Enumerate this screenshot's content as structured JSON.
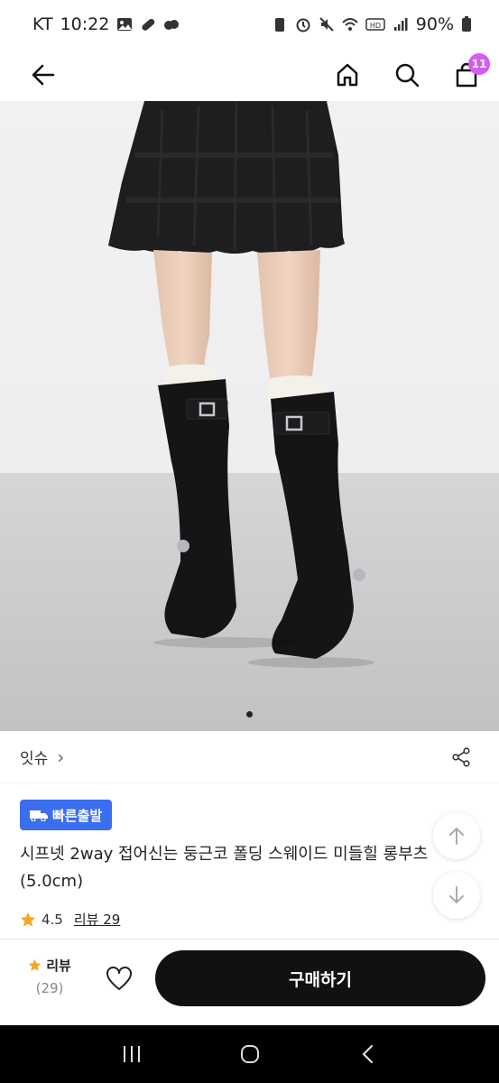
{
  "status_bar": {
    "carrier": "KT",
    "time": "10:22",
    "battery": "90%",
    "left_icons": [
      "gallery-icon",
      "pill-icon",
      "cloud-icon"
    ],
    "right_icons": [
      "battery-saver-icon",
      "alarm-icon",
      "mute-icon",
      "wifi-icon",
      "hd-icon",
      "signal-icon",
      "battery-icon"
    ]
  },
  "nav": {
    "cart_count": "11",
    "badge_color": "#d65bf0"
  },
  "carousel": {
    "page_count": 1,
    "current_index": 0
  },
  "brand": {
    "name": "잇슈",
    "chevron": "›"
  },
  "product": {
    "fast_badge": "빠른출발",
    "title": "시프넷 2way 접어신는 둥근코 폴딩 스웨이드 미들힐 롱부츠 (5.0cm)",
    "rating": "4.5",
    "review_link": "리뷰 29",
    "accent": "#3c6ef0",
    "star_color": "#f5a623"
  },
  "bottom": {
    "review_label": "리뷰",
    "review_count": "(29)",
    "buy_label": "구매하기"
  }
}
